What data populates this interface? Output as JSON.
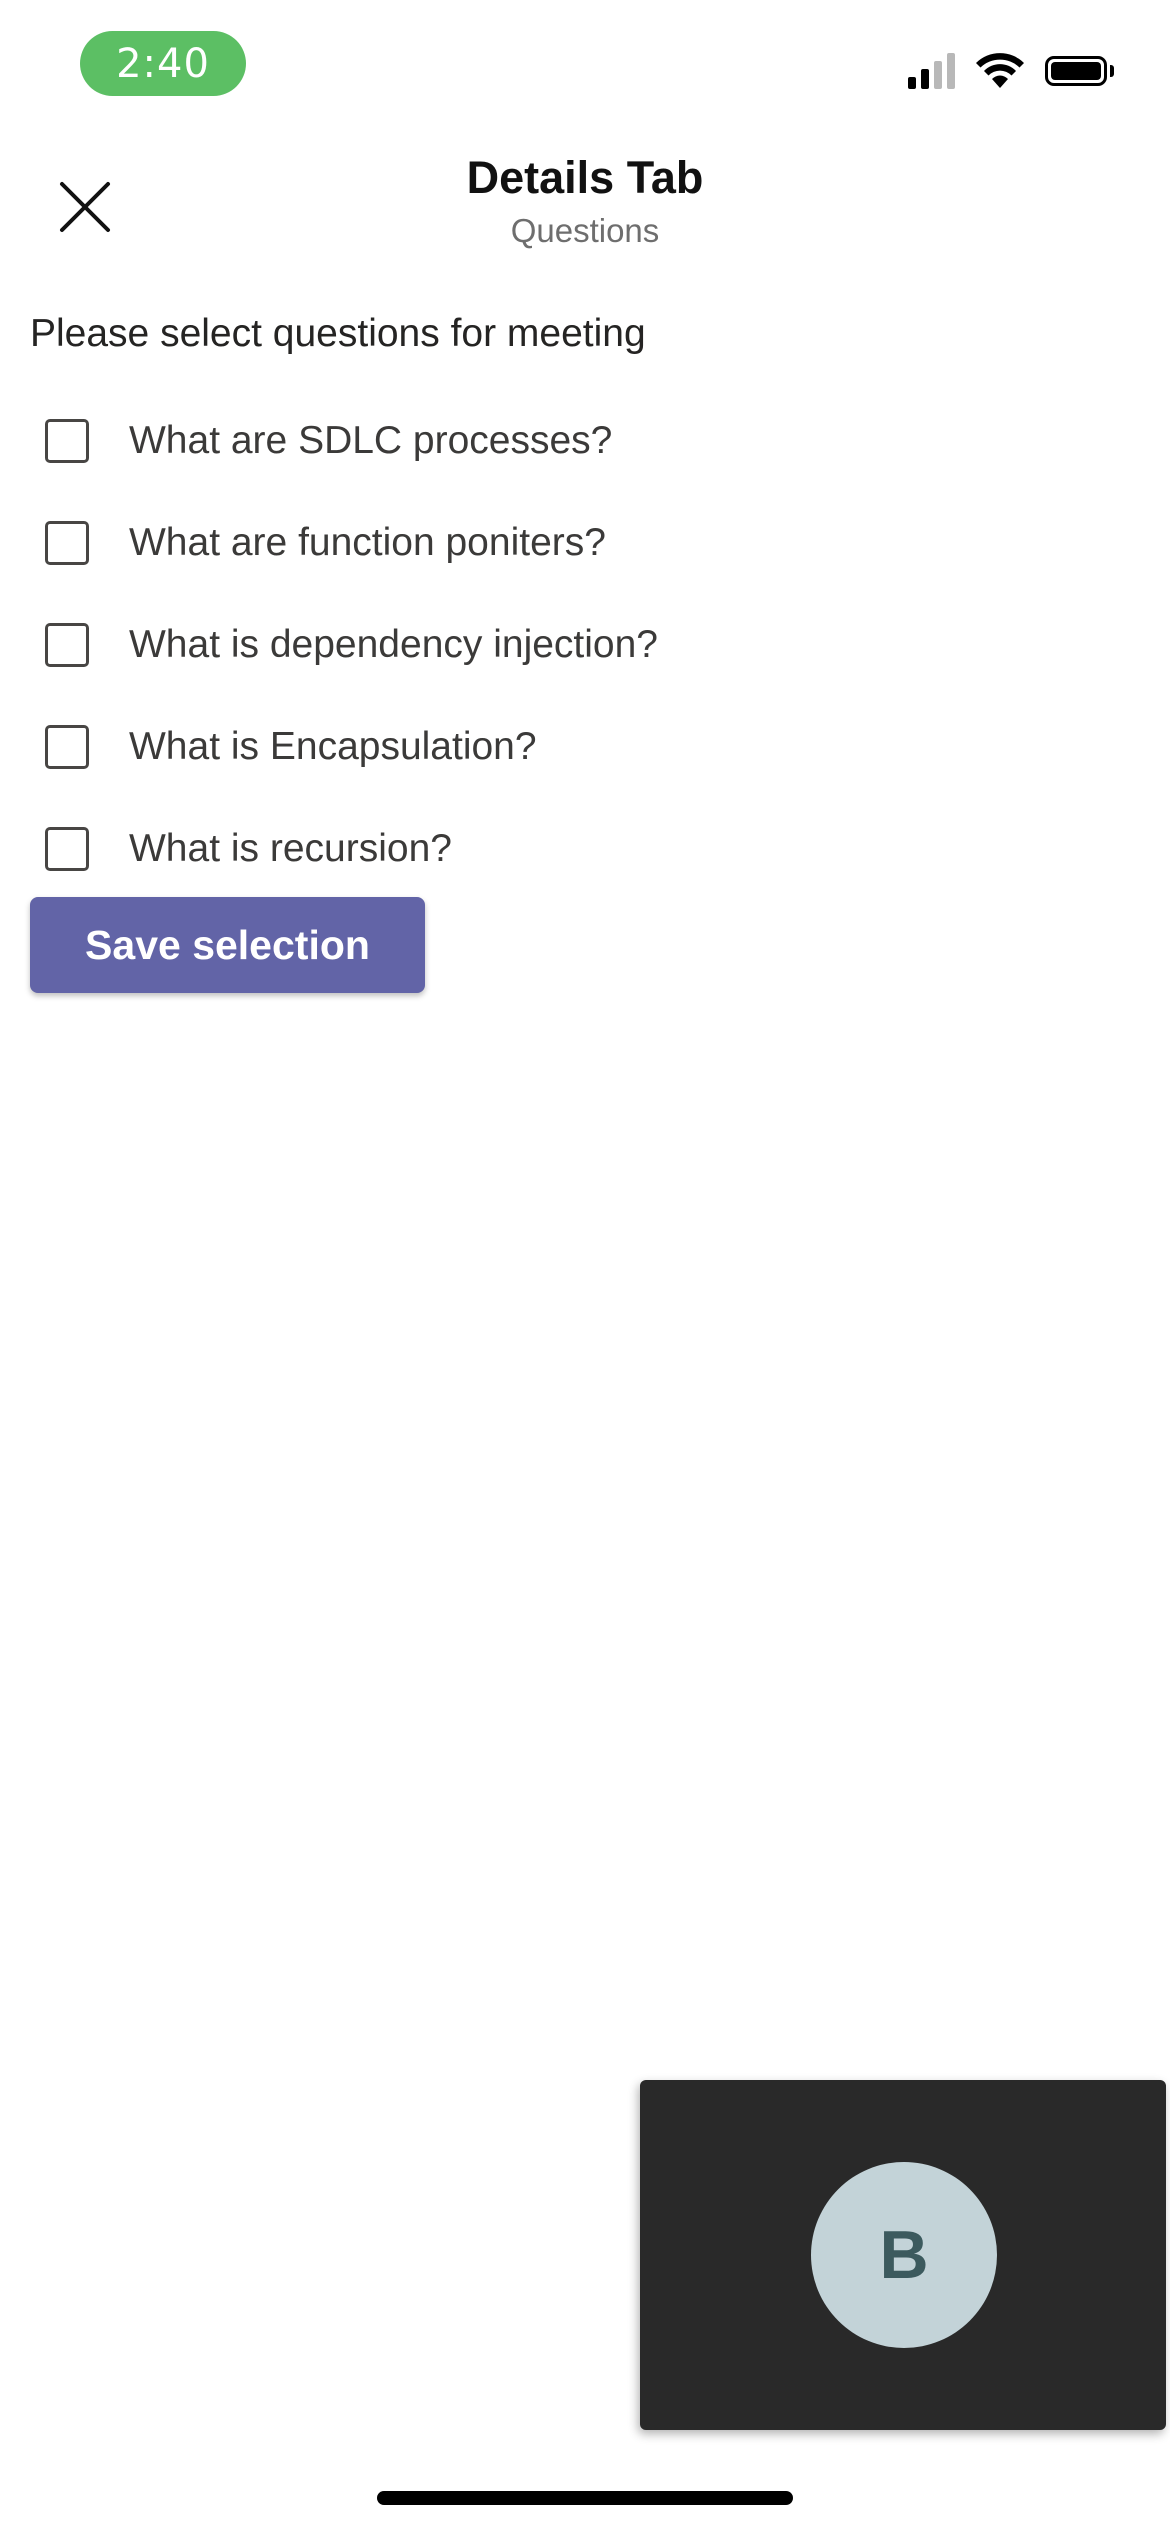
{
  "status_bar": {
    "time": "2:40",
    "time_pill_color": "#5cbf64",
    "icons": [
      "cellular-signal-icon",
      "wifi-icon",
      "battery-icon"
    ]
  },
  "header": {
    "title": "Details Tab",
    "subtitle": "Questions",
    "close_icon": "close-icon"
  },
  "content": {
    "prompt": "Please select questions for meeting",
    "questions": [
      {
        "label": "What are SDLC processes?",
        "checked": false
      },
      {
        "label": "What are function poniters?",
        "checked": false
      },
      {
        "label": "What is dependency injection?",
        "checked": false
      },
      {
        "label": "What is Encapsulation?",
        "checked": false
      },
      {
        "label": "What is recursion?",
        "checked": false
      }
    ],
    "save_label": "Save selection",
    "accent_color": "#6264a7"
  },
  "video_tile": {
    "avatar_initial": "B",
    "avatar_color": "#c3d3d8",
    "background_color": "#292929"
  }
}
